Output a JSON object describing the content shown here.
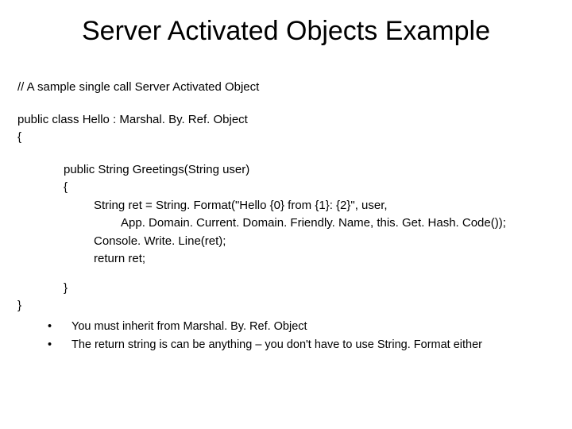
{
  "title": "Server Activated Objects Example",
  "code": {
    "comment": "// A sample single call Server Activated Object",
    "classDecl": "public class Hello : Marshal. By. Ref. Object",
    "braceOpen": "{",
    "methodSig": "public String Greetings(String user)",
    "methodOpen": "{",
    "line1": "String ret = String. Format(\"Hello {0} from {1}: {2}\", user,",
    "line2": "App. Domain. Current. Domain. Friendly. Name, this. Get. Hash. Code());",
    "line3": "Console. Write. Line(ret);",
    "line4": "return ret;",
    "methodClose": "}",
    "classClose": "}"
  },
  "bullets": {
    "dot": "•",
    "item1": "You must inherit from Marshal. By. Ref. Object",
    "item2": "The return string is can be anything – you don't have to use String. Format either"
  }
}
